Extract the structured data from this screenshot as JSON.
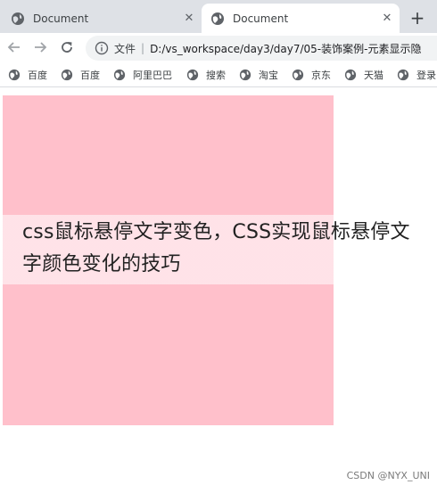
{
  "tabs": [
    {
      "title": "Document",
      "active": false
    },
    {
      "title": "Document",
      "active": true
    }
  ],
  "tab_close_glyph": "✕",
  "new_tab_glyph": "+",
  "address": {
    "scheme_label": "文件",
    "separator": "|",
    "url": "D:/vs_workspace/day3/day7/05-装饰案例-元素显示隐"
  },
  "bookmarks": [
    {
      "label": "百度",
      "icon": "globe-icon"
    },
    {
      "label": "百度",
      "icon": "globe-icon"
    },
    {
      "label": "阿里巴巴",
      "icon": "globe-icon"
    },
    {
      "label": "搜索",
      "icon": "globe-icon"
    },
    {
      "label": "淘宝",
      "icon": "globe-icon"
    },
    {
      "label": "京东",
      "icon": "globe-icon"
    },
    {
      "label": "天猫",
      "icon": "globe-icon"
    },
    {
      "label": "登录",
      "icon": "globe-icon"
    }
  ],
  "content": {
    "box_color": "#ffc0cb",
    "overlay_text": "css鼠标悬停文字变色，CSS实现鼠标悬停文字颜色变化的技巧"
  },
  "watermark": "CSDN @NYX_UNI"
}
